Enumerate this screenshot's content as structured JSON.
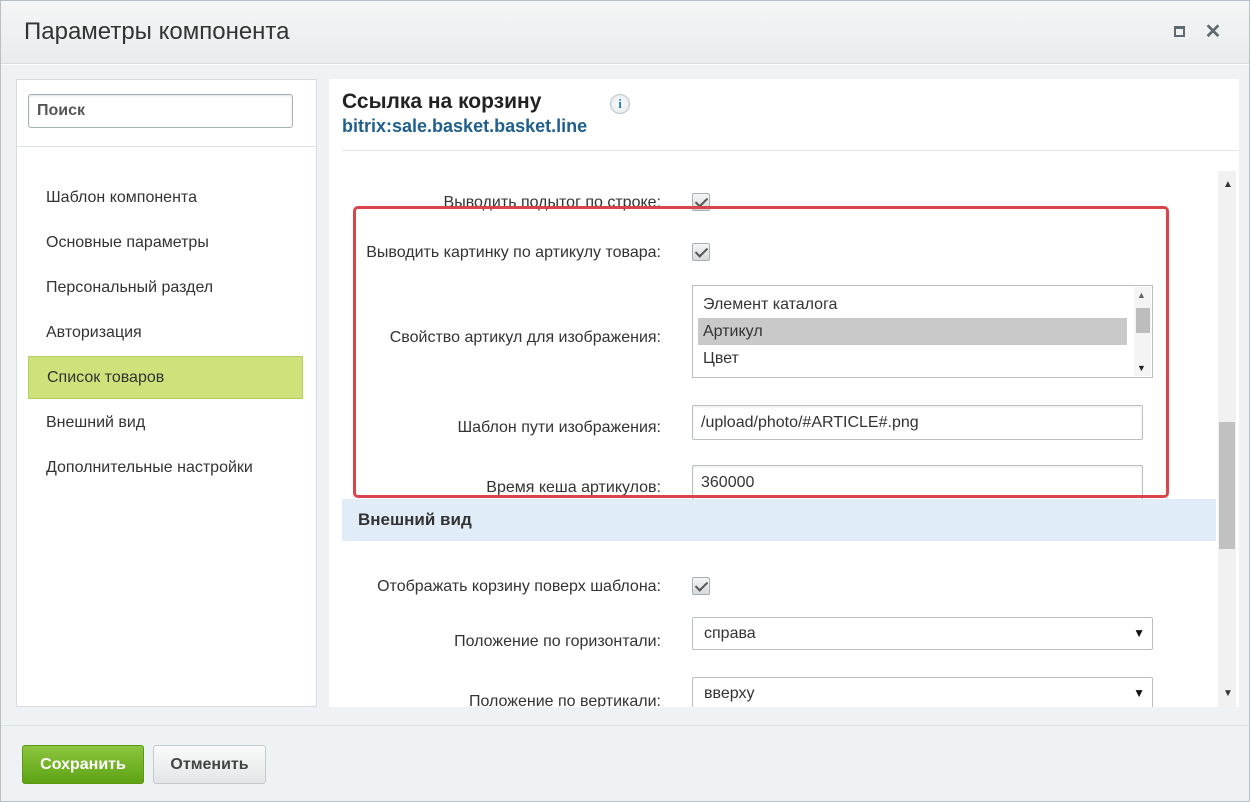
{
  "window": {
    "title": "Параметры компонента",
    "maximize_icon": "maximize-icon",
    "close_icon": "close-icon"
  },
  "sidebar": {
    "search_placeholder": "Поиск",
    "items": [
      {
        "label": "Шаблон компонента",
        "active": false
      },
      {
        "label": "Основные параметры",
        "active": false
      },
      {
        "label": "Персональный раздел",
        "active": false
      },
      {
        "label": "Авторизация",
        "active": false
      },
      {
        "label": "Список товаров",
        "active": true
      },
      {
        "label": "Внешний вид",
        "active": false
      },
      {
        "label": "Дополнительные настройки",
        "active": false
      }
    ],
    "active_color": "#cde27a"
  },
  "component": {
    "name": "Ссылка на корзину",
    "code": "bitrix:sale.basket.basket.line",
    "info_icon": "i"
  },
  "params": {
    "subtotal": {
      "label": "Выводить подытог по строке:",
      "checked": true
    },
    "article_image": {
      "label": "Выводить картинку по артикулу товара:",
      "checked": true
    },
    "article_property": {
      "label": "Свойство артикул для изображения:",
      "options": [
        "Элемент каталога",
        "Артикул",
        "Цвет"
      ],
      "selected": "Артикул"
    },
    "image_path": {
      "label": "Шаблон пути изображения:",
      "value": "/upload/photo/#ARTICLE#.png"
    },
    "cache_time": {
      "label": "Время кеша артикулов:",
      "value": "360000"
    }
  },
  "section_appearance": {
    "title": "Внешний вид",
    "show_over_template": {
      "label": "Отображать корзину поверх шаблона:",
      "checked": true
    },
    "horizontal": {
      "label": "Положение по горизонтали:",
      "value": "справа"
    },
    "vertical": {
      "label": "Положение по вертикали:",
      "value": "вверху"
    }
  },
  "footer": {
    "save_label": "Сохранить",
    "cancel_label": "Отменить"
  },
  "colors": {
    "highlight_border": "#d9444b",
    "section_bg": "#e0edf8",
    "save_button": "#6fb023",
    "code_link": "#1f5f8f"
  }
}
